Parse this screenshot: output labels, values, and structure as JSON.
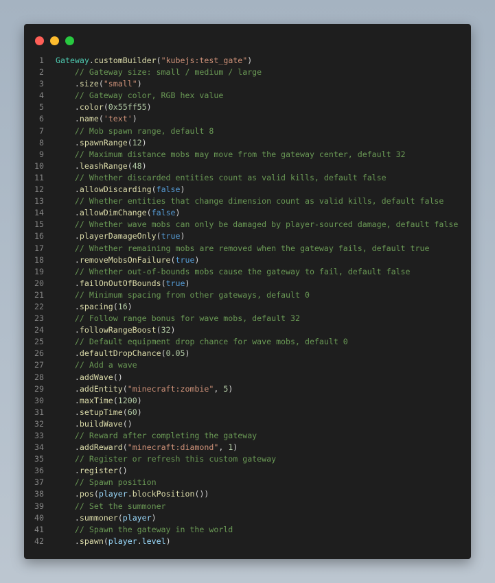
{
  "window": {
    "controls": [
      "close",
      "minimize",
      "maximize"
    ]
  },
  "code_lines": [
    {
      "n": "1",
      "tokens": [
        {
          "t": "Gateway",
          "k": "class"
        },
        {
          "t": ".",
          "k": "punct"
        },
        {
          "t": "customBuilder",
          "k": "func"
        },
        {
          "t": "(",
          "k": "punct"
        },
        {
          "t": "\"kubejs:test_gate\"",
          "k": "string"
        },
        {
          "t": ")",
          "k": "punct"
        }
      ]
    },
    {
      "n": "2",
      "tokens": [
        {
          "t": "    // Gateway size: small / medium / large",
          "k": "comment"
        }
      ]
    },
    {
      "n": "3",
      "tokens": [
        {
          "t": "    .",
          "k": "punct"
        },
        {
          "t": "size",
          "k": "func"
        },
        {
          "t": "(",
          "k": "punct"
        },
        {
          "t": "\"small\"",
          "k": "string"
        },
        {
          "t": ")",
          "k": "punct"
        }
      ]
    },
    {
      "n": "4",
      "tokens": [
        {
          "t": "    // Gateway color, RGB hex value",
          "k": "comment"
        }
      ]
    },
    {
      "n": "5",
      "tokens": [
        {
          "t": "    .",
          "k": "punct"
        },
        {
          "t": "color",
          "k": "func"
        },
        {
          "t": "(",
          "k": "punct"
        },
        {
          "t": "0x55ff55",
          "k": "number"
        },
        {
          "t": ")",
          "k": "punct"
        }
      ]
    },
    {
      "n": "6",
      "tokens": [
        {
          "t": "    .",
          "k": "punct"
        },
        {
          "t": "name",
          "k": "func"
        },
        {
          "t": "(",
          "k": "punct"
        },
        {
          "t": "'text'",
          "k": "string"
        },
        {
          "t": ")",
          "k": "punct"
        }
      ]
    },
    {
      "n": "7",
      "tokens": [
        {
          "t": "    // Mob spawn range, default 8",
          "k": "comment"
        }
      ]
    },
    {
      "n": "8",
      "tokens": [
        {
          "t": "    .",
          "k": "punct"
        },
        {
          "t": "spawnRange",
          "k": "func"
        },
        {
          "t": "(",
          "k": "punct"
        },
        {
          "t": "12",
          "k": "number"
        },
        {
          "t": ")",
          "k": "punct"
        }
      ]
    },
    {
      "n": "9",
      "tokens": [
        {
          "t": "    // Maximum distance mobs may move from the gateway center, default 32",
          "k": "comment"
        }
      ]
    },
    {
      "n": "10",
      "tokens": [
        {
          "t": "    .",
          "k": "punct"
        },
        {
          "t": "leashRange",
          "k": "func"
        },
        {
          "t": "(",
          "k": "punct"
        },
        {
          "t": "48",
          "k": "number"
        },
        {
          "t": ")",
          "k": "punct"
        }
      ]
    },
    {
      "n": "11",
      "tokens": [
        {
          "t": "    // Whether discarded entities count as valid kills, default false",
          "k": "comment"
        }
      ]
    },
    {
      "n": "12",
      "tokens": [
        {
          "t": "    .",
          "k": "punct"
        },
        {
          "t": "allowDiscarding",
          "k": "func"
        },
        {
          "t": "(",
          "k": "punct"
        },
        {
          "t": "false",
          "k": "keyword"
        },
        {
          "t": ")",
          "k": "punct"
        }
      ]
    },
    {
      "n": "13",
      "tokens": [
        {
          "t": "    // Whether entities that change dimension count as valid kills, default false",
          "k": "comment"
        }
      ]
    },
    {
      "n": "14",
      "tokens": [
        {
          "t": "    .",
          "k": "punct"
        },
        {
          "t": "allowDimChange",
          "k": "func"
        },
        {
          "t": "(",
          "k": "punct"
        },
        {
          "t": "false",
          "k": "keyword"
        },
        {
          "t": ")",
          "k": "punct"
        }
      ]
    },
    {
      "n": "15",
      "tokens": [
        {
          "t": "    // Whether wave mobs can only be damaged by player-sourced damage, default false",
          "k": "comment"
        }
      ]
    },
    {
      "n": "16",
      "tokens": [
        {
          "t": "    .",
          "k": "punct"
        },
        {
          "t": "playerDamageOnly",
          "k": "func"
        },
        {
          "t": "(",
          "k": "punct"
        },
        {
          "t": "true",
          "k": "keyword"
        },
        {
          "t": ")",
          "k": "punct"
        }
      ]
    },
    {
      "n": "17",
      "tokens": [
        {
          "t": "    // Whether remaining mobs are removed when the gateway fails, default true",
          "k": "comment"
        }
      ]
    },
    {
      "n": "18",
      "tokens": [
        {
          "t": "    .",
          "k": "punct"
        },
        {
          "t": "removeMobsOnFailure",
          "k": "func"
        },
        {
          "t": "(",
          "k": "punct"
        },
        {
          "t": "true",
          "k": "keyword"
        },
        {
          "t": ")",
          "k": "punct"
        }
      ]
    },
    {
      "n": "19",
      "tokens": [
        {
          "t": "    // Whether out-of-bounds mobs cause the gateway to fail, default false",
          "k": "comment"
        }
      ]
    },
    {
      "n": "20",
      "tokens": [
        {
          "t": "    .",
          "k": "punct"
        },
        {
          "t": "failOnOutOfBounds",
          "k": "func"
        },
        {
          "t": "(",
          "k": "punct"
        },
        {
          "t": "true",
          "k": "keyword"
        },
        {
          "t": ")",
          "k": "punct"
        }
      ]
    },
    {
      "n": "21",
      "tokens": [
        {
          "t": "    // Minimum spacing from other gateways, default 0",
          "k": "comment"
        }
      ]
    },
    {
      "n": "22",
      "tokens": [
        {
          "t": "    .",
          "k": "punct"
        },
        {
          "t": "spacing",
          "k": "func"
        },
        {
          "t": "(",
          "k": "punct"
        },
        {
          "t": "16",
          "k": "number"
        },
        {
          "t": ")",
          "k": "punct"
        }
      ]
    },
    {
      "n": "23",
      "tokens": [
        {
          "t": "    // Follow range bonus for wave mobs, default 32",
          "k": "comment"
        }
      ]
    },
    {
      "n": "24",
      "tokens": [
        {
          "t": "    .",
          "k": "punct"
        },
        {
          "t": "followRangeBoost",
          "k": "func"
        },
        {
          "t": "(",
          "k": "punct"
        },
        {
          "t": "32",
          "k": "number"
        },
        {
          "t": ")",
          "k": "punct"
        }
      ]
    },
    {
      "n": "25",
      "tokens": [
        {
          "t": "    // Default equipment drop chance for wave mobs, default 0",
          "k": "comment"
        }
      ]
    },
    {
      "n": "26",
      "tokens": [
        {
          "t": "    .",
          "k": "punct"
        },
        {
          "t": "defaultDropChance",
          "k": "func"
        },
        {
          "t": "(",
          "k": "punct"
        },
        {
          "t": "0.05",
          "k": "number"
        },
        {
          "t": ")",
          "k": "punct"
        }
      ]
    },
    {
      "n": "27",
      "tokens": [
        {
          "t": "    // Add a wave",
          "k": "comment"
        }
      ]
    },
    {
      "n": "28",
      "tokens": [
        {
          "t": "    .",
          "k": "punct"
        },
        {
          "t": "addWave",
          "k": "func"
        },
        {
          "t": "()",
          "k": "punct"
        }
      ]
    },
    {
      "n": "29",
      "tokens": [
        {
          "t": "    .",
          "k": "punct"
        },
        {
          "t": "addEntity",
          "k": "func"
        },
        {
          "t": "(",
          "k": "punct"
        },
        {
          "t": "\"minecraft:zombie\"",
          "k": "string"
        },
        {
          "t": ", ",
          "k": "punct"
        },
        {
          "t": "5",
          "k": "number"
        },
        {
          "t": ")",
          "k": "punct"
        }
      ]
    },
    {
      "n": "30",
      "tokens": [
        {
          "t": "    .",
          "k": "punct"
        },
        {
          "t": "maxTime",
          "k": "func"
        },
        {
          "t": "(",
          "k": "punct"
        },
        {
          "t": "1200",
          "k": "number"
        },
        {
          "t": ")",
          "k": "punct"
        }
      ]
    },
    {
      "n": "31",
      "tokens": [
        {
          "t": "    .",
          "k": "punct"
        },
        {
          "t": "setupTime",
          "k": "func"
        },
        {
          "t": "(",
          "k": "punct"
        },
        {
          "t": "60",
          "k": "number"
        },
        {
          "t": ")",
          "k": "punct"
        }
      ]
    },
    {
      "n": "32",
      "tokens": [
        {
          "t": "    .",
          "k": "punct"
        },
        {
          "t": "buildWave",
          "k": "func"
        },
        {
          "t": "()",
          "k": "punct"
        }
      ]
    },
    {
      "n": "33",
      "tokens": [
        {
          "t": "    // Reward after completing the gateway",
          "k": "comment"
        }
      ]
    },
    {
      "n": "34",
      "tokens": [
        {
          "t": "    .",
          "k": "punct"
        },
        {
          "t": "addReward",
          "k": "func"
        },
        {
          "t": "(",
          "k": "punct"
        },
        {
          "t": "\"minecraft:diamond\"",
          "k": "string"
        },
        {
          "t": ", ",
          "k": "punct"
        },
        {
          "t": "1",
          "k": "number"
        },
        {
          "t": ")",
          "k": "punct"
        }
      ]
    },
    {
      "n": "35",
      "tokens": [
        {
          "t": "    // Register or refresh this custom gateway",
          "k": "comment"
        }
      ]
    },
    {
      "n": "36",
      "tokens": [
        {
          "t": "    .",
          "k": "punct"
        },
        {
          "t": "register",
          "k": "func"
        },
        {
          "t": "()",
          "k": "punct"
        }
      ]
    },
    {
      "n": "37",
      "tokens": [
        {
          "t": "    // Spawn position",
          "k": "comment"
        }
      ]
    },
    {
      "n": "38",
      "tokens": [
        {
          "t": "    .",
          "k": "punct"
        },
        {
          "t": "pos",
          "k": "func"
        },
        {
          "t": "(",
          "k": "punct"
        },
        {
          "t": "player",
          "k": "var"
        },
        {
          "t": ".",
          "k": "punct"
        },
        {
          "t": "blockPosition",
          "k": "func"
        },
        {
          "t": "())",
          "k": "punct"
        }
      ]
    },
    {
      "n": "39",
      "tokens": [
        {
          "t": "    // Set the summoner",
          "k": "comment"
        }
      ]
    },
    {
      "n": "40",
      "tokens": [
        {
          "t": "    .",
          "k": "punct"
        },
        {
          "t": "summoner",
          "k": "func"
        },
        {
          "t": "(",
          "k": "punct"
        },
        {
          "t": "player",
          "k": "var"
        },
        {
          "t": ")",
          "k": "punct"
        }
      ]
    },
    {
      "n": "41",
      "tokens": [
        {
          "t": "    // Spawn the gateway in the world",
          "k": "comment"
        }
      ]
    },
    {
      "n": "42",
      "tokens": [
        {
          "t": "    .",
          "k": "punct"
        },
        {
          "t": "spawn",
          "k": "func"
        },
        {
          "t": "(",
          "k": "punct"
        },
        {
          "t": "player",
          "k": "var"
        },
        {
          "t": ".",
          "k": "punct"
        },
        {
          "t": "level",
          "k": "var"
        },
        {
          "t": ")",
          "k": "punct"
        }
      ]
    }
  ]
}
